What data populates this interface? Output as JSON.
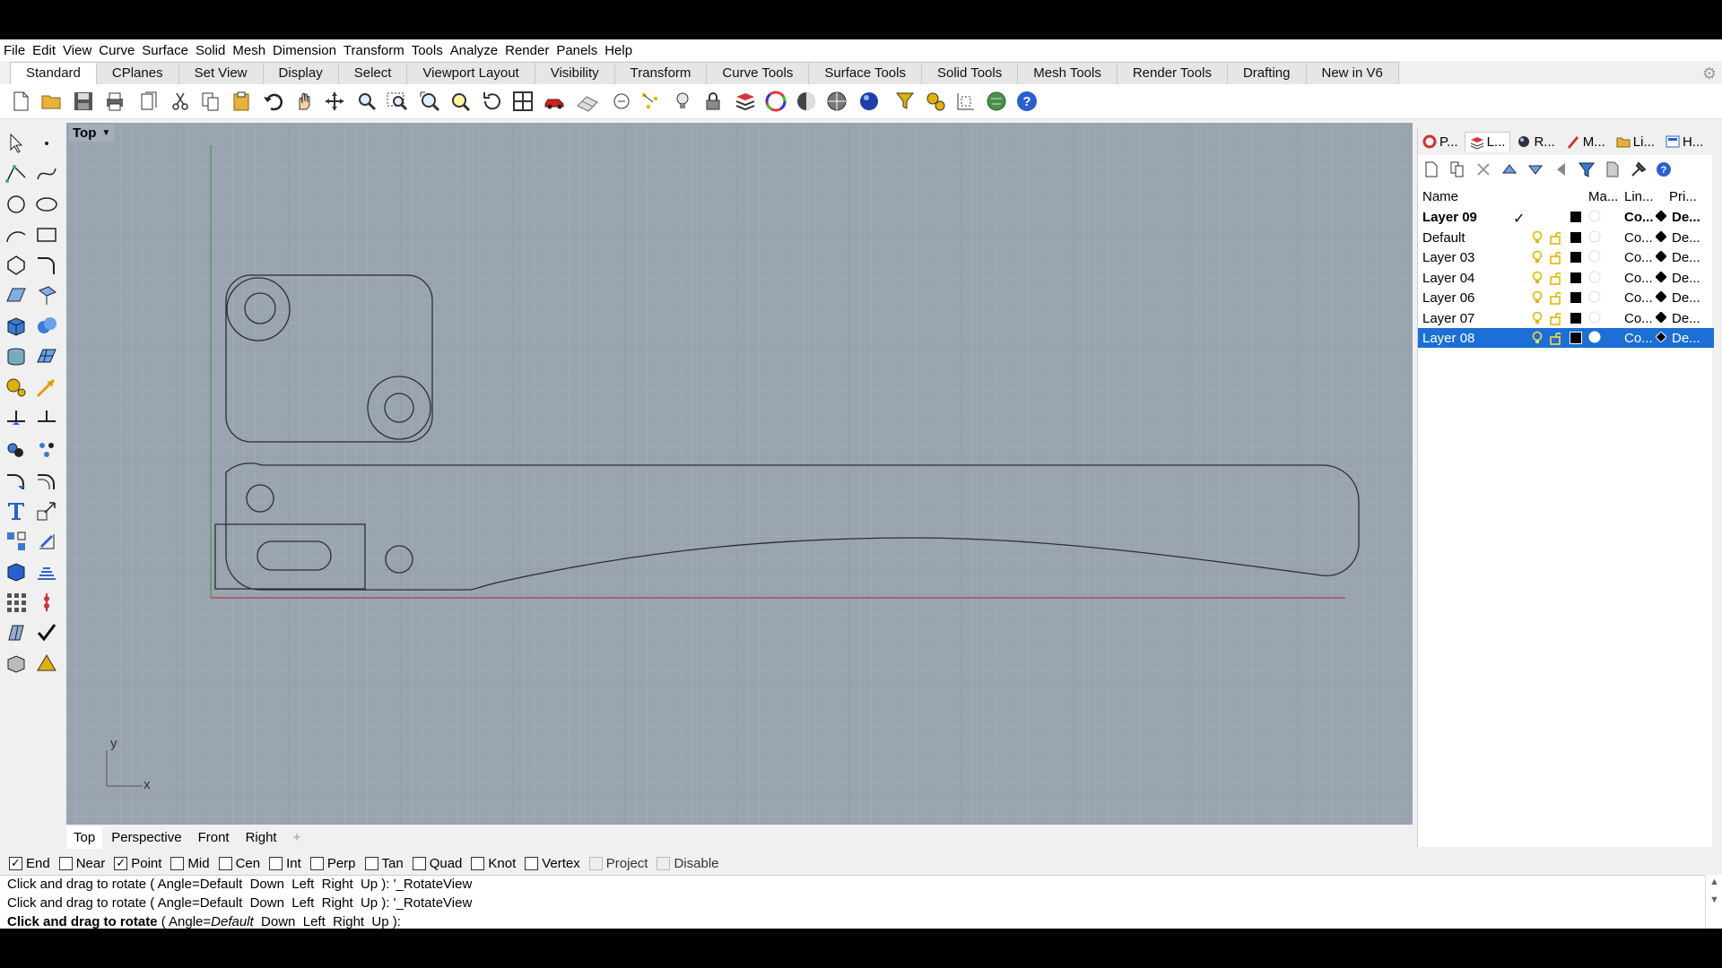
{
  "menu": [
    "File",
    "Edit",
    "View",
    "Curve",
    "Surface",
    "Solid",
    "Mesh",
    "Dimension",
    "Transform",
    "Tools",
    "Analyze",
    "Render",
    "Panels",
    "Help"
  ],
  "toolbar_tabs": [
    "Standard",
    "CPlanes",
    "Set View",
    "Display",
    "Select",
    "Viewport Layout",
    "Visibility",
    "Transform",
    "Curve Tools",
    "Surface Tools",
    "Solid Tools",
    "Mesh Tools",
    "Render Tools",
    "Drafting",
    "New in V6"
  ],
  "active_toolbar_tab": "Standard",
  "viewport": {
    "label": "Top",
    "axis_x": "x",
    "axis_y": "y",
    "tabs": [
      "Top",
      "Perspective",
      "Front",
      "Right"
    ],
    "add_tab_icon": "+"
  },
  "panel": {
    "tabs": [
      {
        "label": "P...",
        "icon": "properties-icon"
      },
      {
        "label": "L...",
        "icon": "layers-icon"
      },
      {
        "label": "R...",
        "icon": "render-icon"
      },
      {
        "label": "M...",
        "icon": "materials-icon"
      },
      {
        "label": "Li...",
        "icon": "libraries-icon"
      },
      {
        "label": "H...",
        "icon": "help-icon"
      }
    ],
    "columns": {
      "name": "Name",
      "material": "Ma...",
      "linetype": "Lin...",
      "print": "Pri..."
    },
    "layers": [
      {
        "name": "Layer 09",
        "current": true,
        "linetype": "Co...",
        "print": "De...",
        "bold": true
      },
      {
        "name": "Default",
        "linetype": "Co...",
        "print": "De..."
      },
      {
        "name": "Layer 03",
        "linetype": "Co...",
        "print": "De..."
      },
      {
        "name": "Layer 04",
        "linetype": "Co...",
        "print": "De..."
      },
      {
        "name": "Layer 06",
        "linetype": "Co...",
        "print": "De..."
      },
      {
        "name": "Layer 07",
        "linetype": "Co...",
        "print": "De..."
      },
      {
        "name": "Layer 08",
        "linetype": "Co...",
        "print": "De...",
        "selected": true
      }
    ],
    "current_mark": "✓"
  },
  "osnaps": [
    {
      "label": "End",
      "checked": true
    },
    {
      "label": "Near",
      "checked": false
    },
    {
      "label": "Point",
      "checked": true
    },
    {
      "label": "Mid",
      "checked": false
    },
    {
      "label": "Cen",
      "checked": false
    },
    {
      "label": "Int",
      "checked": false
    },
    {
      "label": "Perp",
      "checked": false
    },
    {
      "label": "Tan",
      "checked": false
    },
    {
      "label": "Quad",
      "checked": false
    },
    {
      "label": "Knot",
      "checked": false
    },
    {
      "label": "Vertex",
      "checked": false
    },
    {
      "label": "Project",
      "checked": false,
      "disabled": true
    },
    {
      "label": "Disable",
      "checked": false,
      "disabled": true
    }
  ],
  "command": {
    "history1": "Click and drag to rotate ( Angle=Default  Down  Left  Right  Up ): '_RotateView",
    "history2": "Click and drag to rotate ( Angle=Default  Down  Left  Right  Up ): '_RotateView",
    "prompt_bold": "Click and drag to rotate",
    "prompt_open": " ( Angle=",
    "prompt_default": "Default",
    "prompt_rest": "  Down  Left  Right  Up ):"
  },
  "colors": {
    "viewport_bg": "#9aa3b0",
    "selection": "#1b6fd6",
    "x_axis": "#b04040",
    "y_axis": "#4a8f4a"
  }
}
